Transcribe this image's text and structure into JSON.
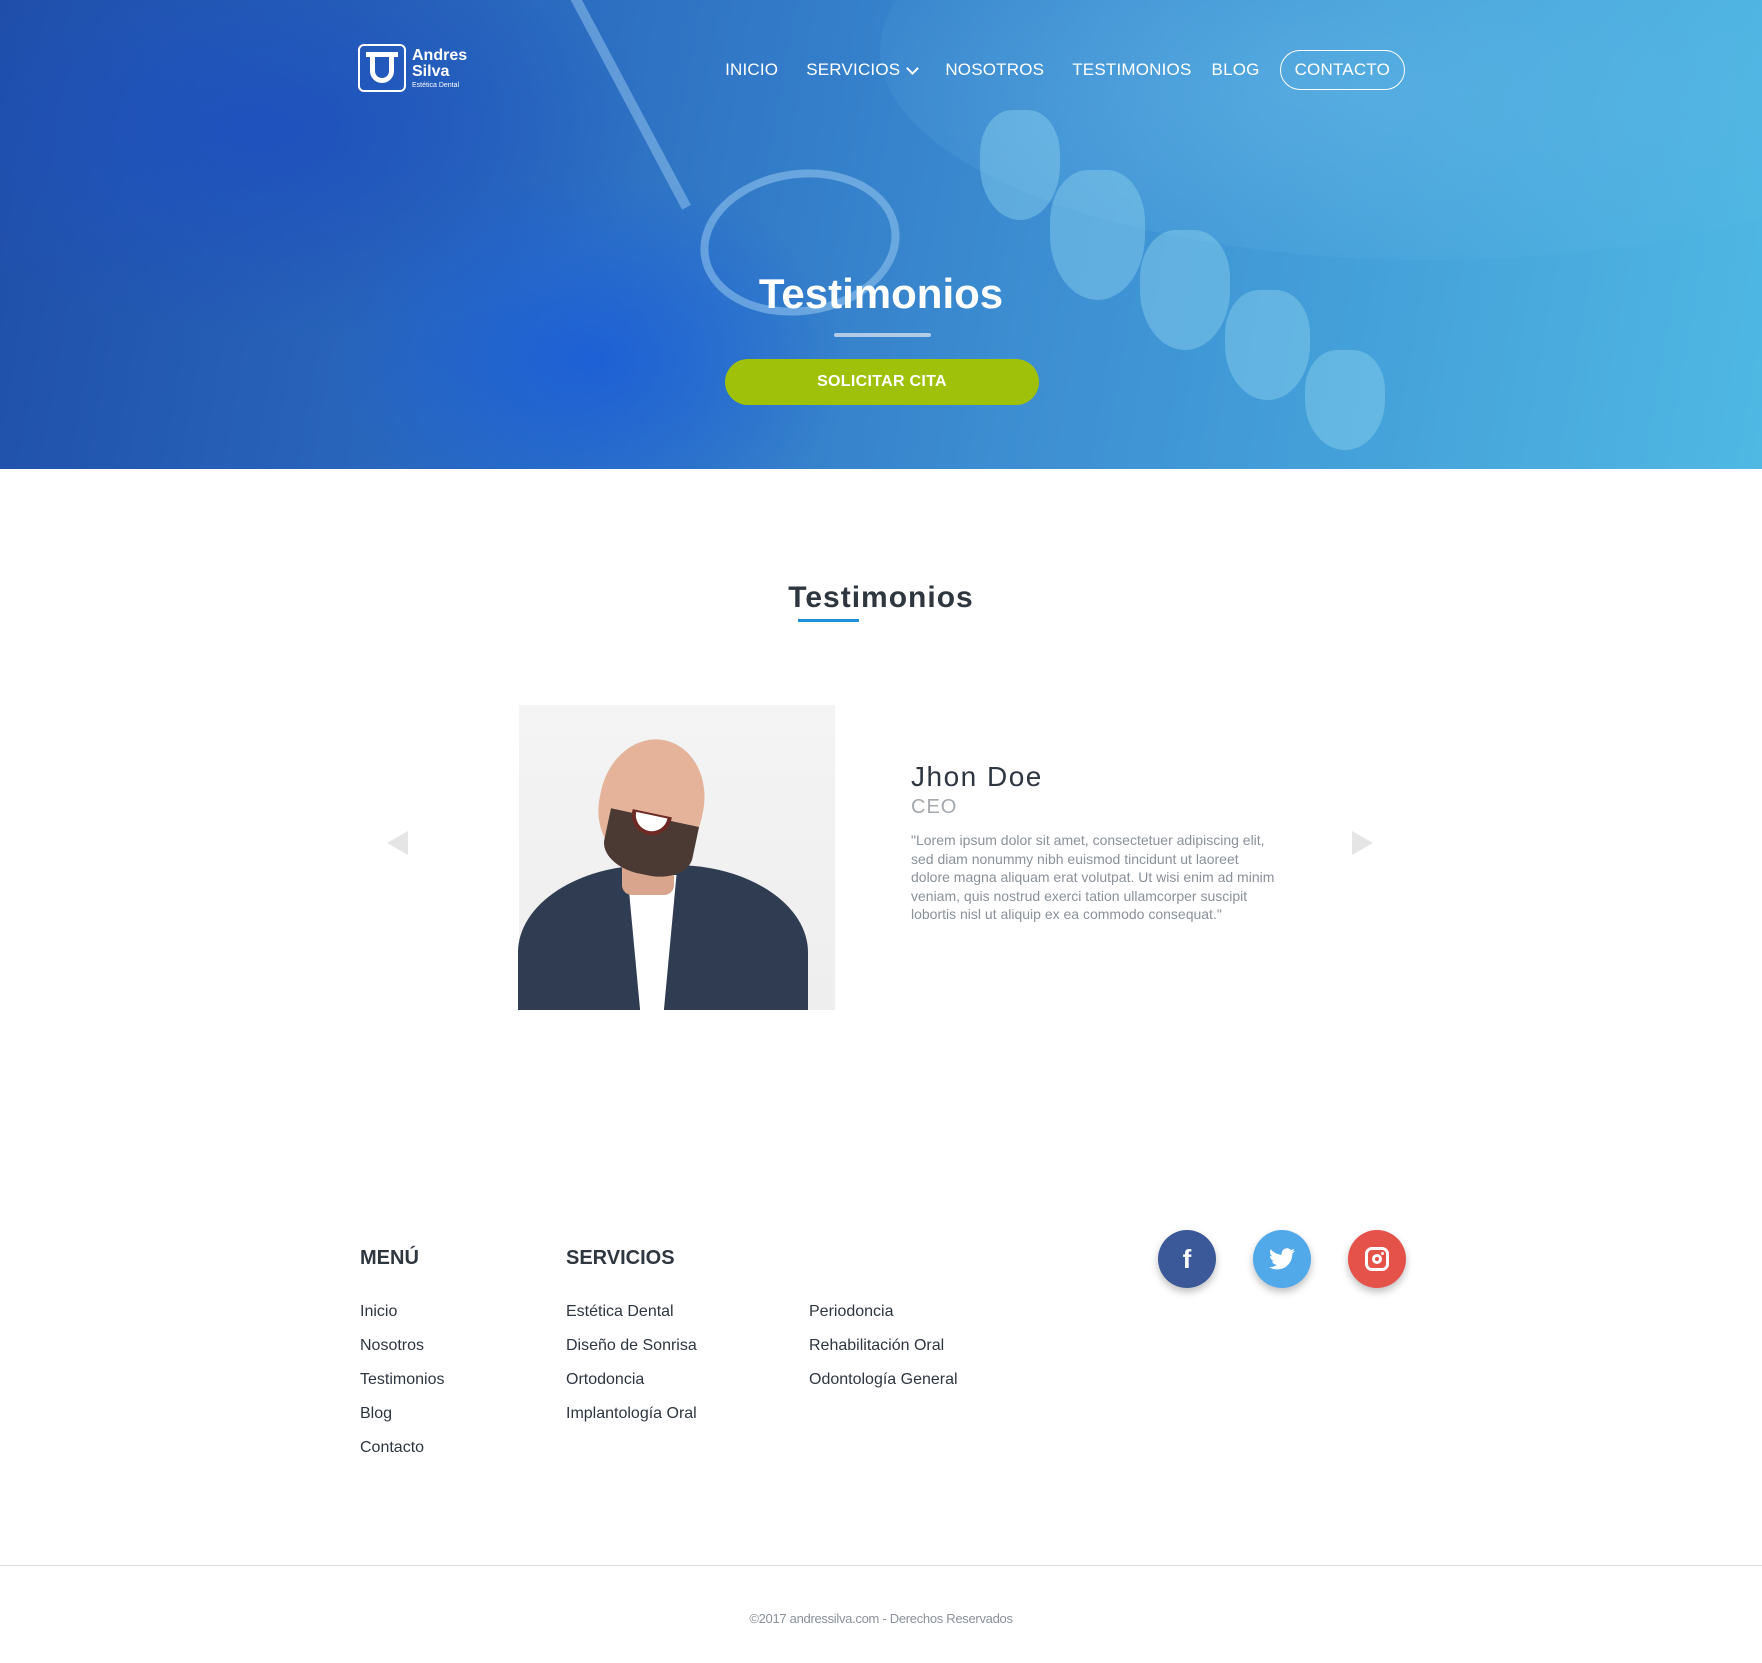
{
  "brand": {
    "name_line1": "Andres",
    "name_line2": "Silva",
    "tagline": "Estética Dental"
  },
  "nav": {
    "items": [
      {
        "label": "INICIO"
      },
      {
        "label": "SERVICIOS"
      },
      {
        "label": "NOSOTROS"
      },
      {
        "label": "TESTIMONIOS"
      },
      {
        "label": "BLOG"
      }
    ],
    "contact_label": "CONTACTO"
  },
  "hero": {
    "title": "Testimonios",
    "cta_label": "SOLICITAR CITA"
  },
  "testimonials": {
    "section_title": "Testimonios",
    "current": {
      "name": "Jhon Doe",
      "role": "CEO",
      "quote": "\"Lorem ipsum dolor sit amet, consectetuer adipiscing elit, sed diam nonummy nibh euismod tincidunt ut laoreet dolore magna aliquam erat volutpat. Ut wisi enim ad minim veniam, quis nostrud exerci tation ullamcorper suscipit lobortis nisl ut aliquip ex ea commodo consequat.\""
    }
  },
  "footer": {
    "menu_title": "MENÚ",
    "menu_items": [
      "Inicio",
      "Nosotros",
      "Testimonios",
      "Blog",
      "Contacto"
    ],
    "services_title": "SERVICIOS",
    "services_col1": [
      "Estética Dental",
      "Diseño de Sonrisa",
      "Ortodoncia",
      "Implantología Oral"
    ],
    "services_col2": [
      "Periodoncia",
      "Rehabilitación Oral",
      "Odontología General"
    ],
    "social": [
      {
        "icon": "facebook-icon",
        "color": "#3b5898"
      },
      {
        "icon": "twitter-icon",
        "color": "#52a9ea"
      },
      {
        "icon": "instagram-icon",
        "color": "#e4524a"
      }
    ],
    "copyright": "©2017 andressilva.com - Derechos Reservados"
  },
  "colors": {
    "accent": "#1e8fdc",
    "cta": "#9fc10a",
    "text_dark": "#2e3640"
  }
}
